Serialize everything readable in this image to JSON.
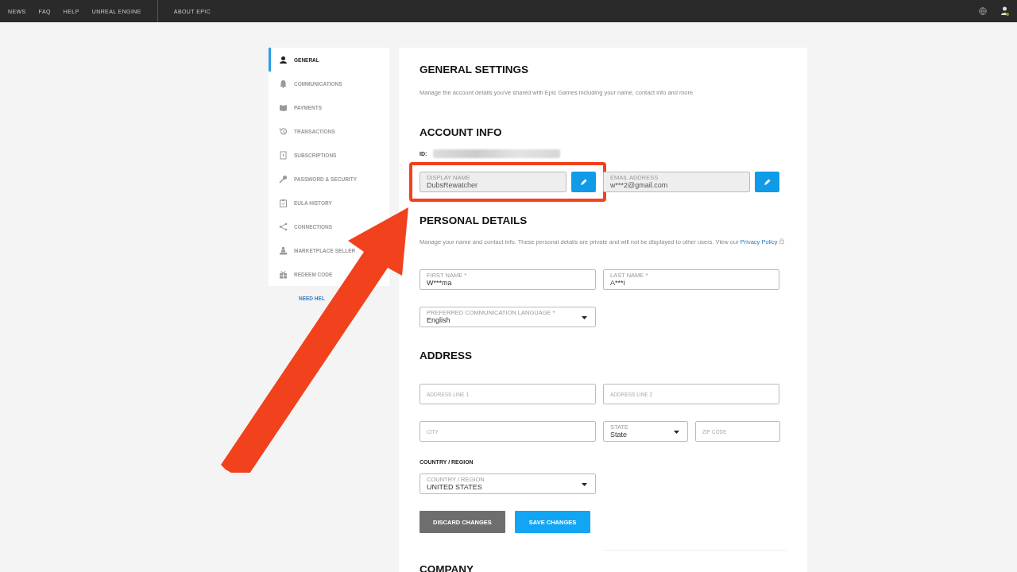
{
  "top_nav": {
    "links": [
      {
        "label": "NEWS"
      },
      {
        "label": "FAQ"
      },
      {
        "label": "HELP"
      },
      {
        "label": "UNREAL ENGINE"
      },
      {
        "label": "ABOUT EPIC",
        "separated": true
      }
    ]
  },
  "sidebar": {
    "items": [
      {
        "label": "GENERAL",
        "selected": true
      },
      {
        "label": "COMMUNICATIONS",
        "selected": false
      },
      {
        "label": "PAYMENTS",
        "selected": false
      },
      {
        "label": "TRANSACTIONS",
        "selected": false
      },
      {
        "label": "SUBSCRIPTIONS",
        "selected": false
      },
      {
        "label": "PASSWORD & SECURITY",
        "selected": false
      },
      {
        "label": "EULA HISTORY",
        "selected": false
      },
      {
        "label": "CONNECTIONS",
        "selected": false
      },
      {
        "label": "MARKETPLACE SELLER",
        "selected": false
      },
      {
        "label": "REDEEM CODE",
        "selected": false
      }
    ],
    "help_link": "NEED HEL"
  },
  "general_settings": {
    "title": "GENERAL SETTINGS",
    "description": "Manage the account details you've shared with Epic Games including your name, contact info and more"
  },
  "account_info": {
    "title": "ACCOUNT INFO",
    "id_label": "ID:",
    "fields": [
      {
        "label": "DISPLAY NAME",
        "value": "DubsRewatcher",
        "disabled": true,
        "highlighted": true
      },
      {
        "label": "EMAIL ADDRESS",
        "value": "w***2@gmail.com",
        "disabled": true,
        "highlighted": false
      }
    ]
  },
  "personal_details": {
    "title": "PERSONAL DETAILS",
    "description": "Manage your name and contact info. These personal details are private and will not be displayed to other users. View our",
    "privacy_link": "Privacy Policy",
    "rows": [
      [
        {
          "kind": "text",
          "label": "FIRST NAME *",
          "value": "W***ma"
        },
        {
          "kind": "text",
          "label": "LAST NAME *",
          "value": "A***i"
        }
      ],
      [
        {
          "kind": "select",
          "label": "PREFERRED COMMUNICATION LANGUAGE *",
          "value": "English"
        }
      ]
    ]
  },
  "address": {
    "title": "ADDRESS",
    "rows": [
      [
        {
          "kind": "text",
          "placeholder": "ADDRESS LINE 1"
        },
        {
          "kind": "text",
          "placeholder": "ADDRESS LINE 2"
        }
      ],
      [
        {
          "kind": "text",
          "placeholder": "CITY"
        },
        {
          "kind": "select",
          "label": "STATE",
          "value": "State"
        },
        {
          "kind": "text",
          "placeholder": "ZIP CODE"
        }
      ]
    ],
    "country_heading": "COUNTRY / REGION",
    "country": {
      "kind": "select",
      "label": "COUNTRY / REGION",
      "value": "UNITED STATES"
    }
  },
  "buttons": [
    {
      "label": "DISCARD CHANGES",
      "kind": "secondary"
    },
    {
      "label": "SAVE CHANGES",
      "kind": "primary"
    }
  ],
  "next_section": {
    "title": "COMPANY"
  }
}
